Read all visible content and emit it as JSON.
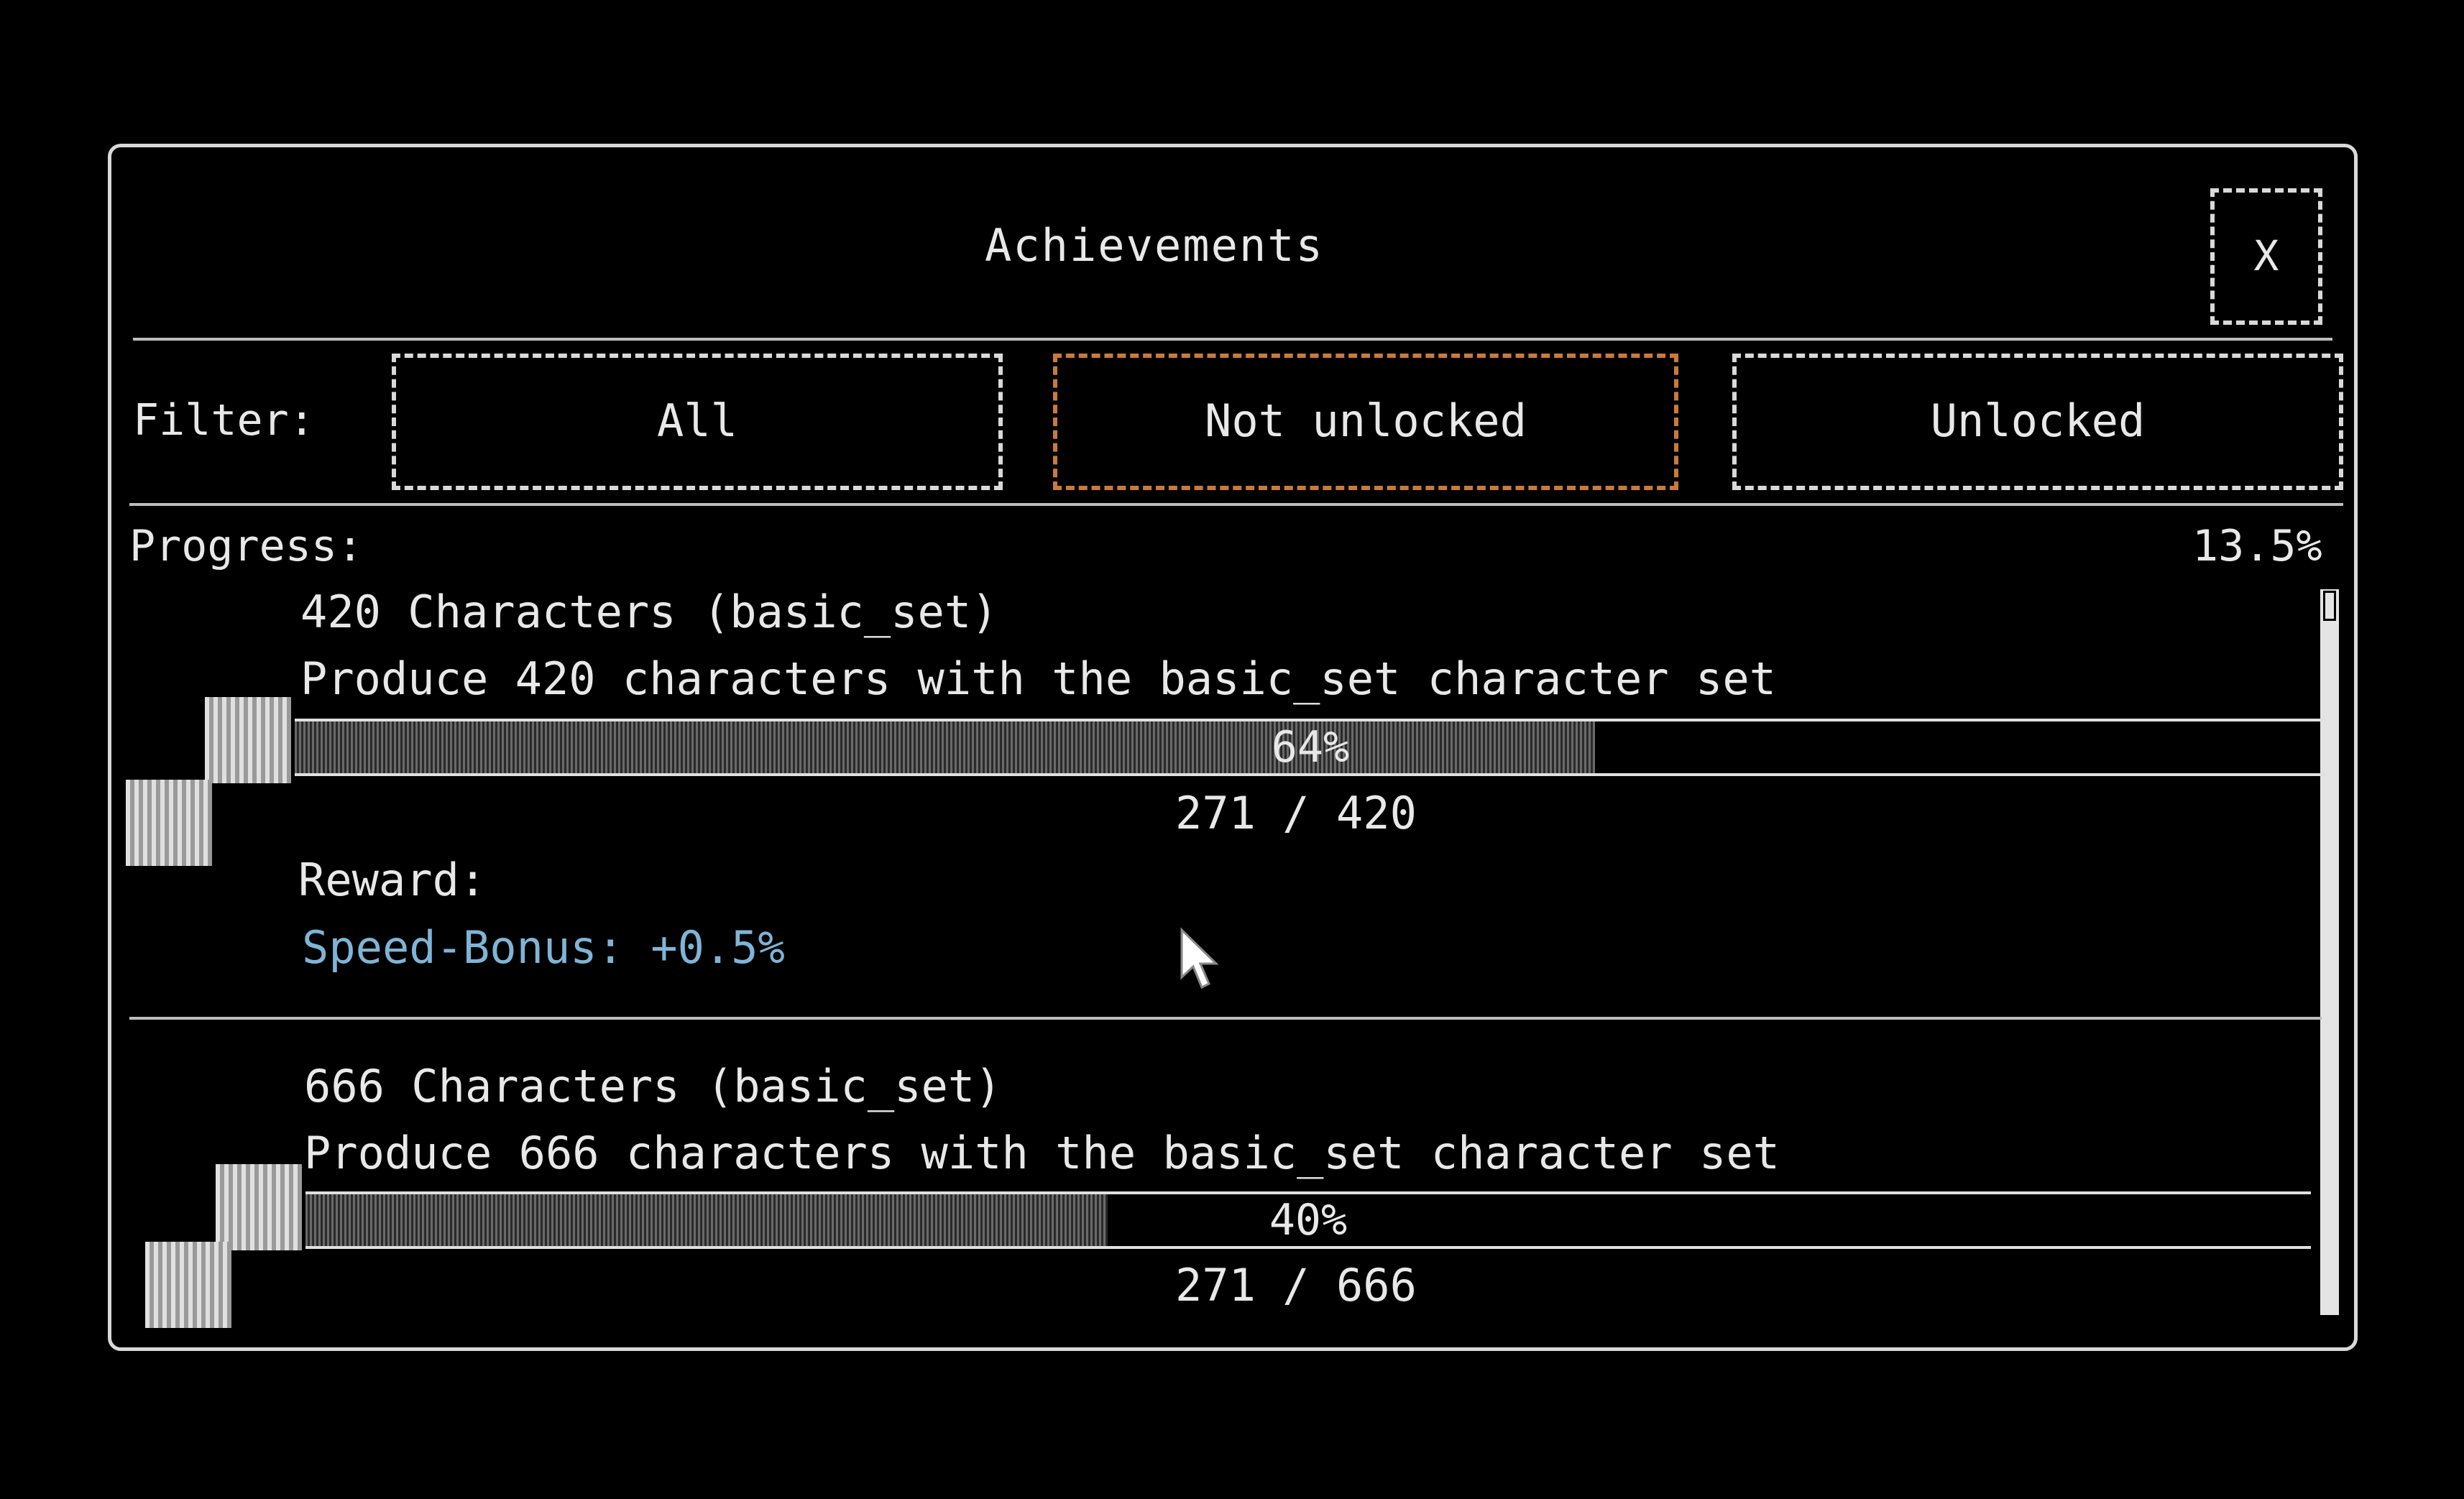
{
  "window": {
    "title": "Achievements",
    "close_label": "X"
  },
  "filter": {
    "label": "Filter:",
    "options": [
      {
        "label": "All"
      },
      {
        "label": "Not unlocked",
        "active": true
      },
      {
        "label": "Unlocked"
      }
    ]
  },
  "progress": {
    "label": "Progress:",
    "value": "13.5%"
  },
  "achievements": [
    {
      "title": "420 Characters (basic_set)",
      "description": "Produce 420 characters with the basic_set character set",
      "percent_label": "64%",
      "progress_fraction": 0.64,
      "count": "271 / 420",
      "reward_label": "Reward:",
      "reward_value": "Speed-Bonus: +0.5%"
    },
    {
      "title": "666 Characters (basic_set)",
      "description": "Produce 666 characters with the basic_set character set",
      "percent_label": "40%",
      "progress_fraction": 0.4,
      "count": "271 / 666"
    }
  ],
  "colors": {
    "background": "#000000",
    "text": "#e8e8e8",
    "active_filter": "#c97a3c",
    "reward": "#7fb4d6"
  },
  "icons": [
    "close-icon",
    "achievement-icon",
    "mouse-cursor-icon"
  ]
}
